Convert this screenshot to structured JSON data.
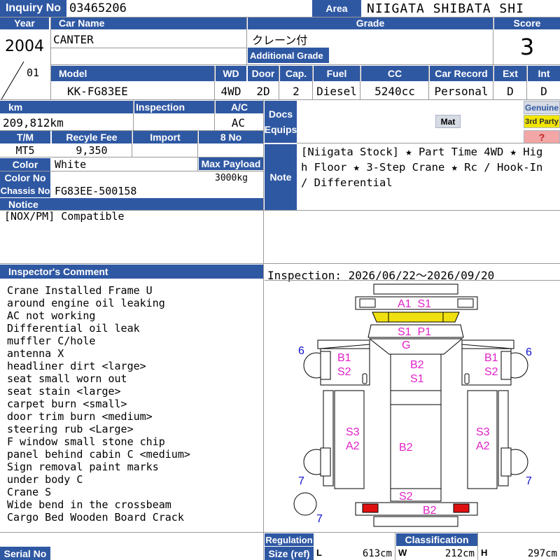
{
  "header": {
    "inquiry_label": "Inquiry No",
    "inquiry_no": "03465206",
    "area_label": "Area",
    "area": "NIIGATA SHIBATA SHI"
  },
  "vehicle": {
    "year_label": "Year",
    "year": "2004",
    "month": "01",
    "car_name_label": "Car Name",
    "car_name": "CANTER",
    "grade_label": "Grade",
    "grade": "クレーン付",
    "additional_grade_label": "Additional Grade",
    "additional_grade": "",
    "score_label": "Score",
    "score": "3"
  },
  "specs": {
    "model_label": "Model",
    "model": "KK-FG83EE",
    "wd_label": "WD",
    "wd": "4WD",
    "door_label": "Door",
    "door": "2D",
    "cap_label": "Cap.",
    "cap": "2",
    "fuel_label": "Fuel",
    "fuel": "Diesel",
    "cc_label": "CC",
    "cc": "5240cc",
    "record_label": "Car Record",
    "record": "Personal",
    "ext_label": "Ext",
    "ext": "D",
    "int_label": "Int",
    "int": "D"
  },
  "details": {
    "km_label": "km",
    "km": "209,812km",
    "inspection_label": "Inspection",
    "inspection": "",
    "ac_label": "A/C",
    "ac": "AC",
    "docs_label": "Docs",
    "equips_label": "Equips",
    "tm_label": "T/M",
    "tm": "MT5",
    "recycle_label": "Recyle Fee",
    "recycle": "9,350",
    "import_label": "Import",
    "import": "",
    "no8_label": "8 No",
    "no8": "",
    "color_label": "Color",
    "color": "White",
    "payload_label": "Max Payload",
    "payload": "3000kg",
    "colorno_label": "Color No",
    "colorno": "",
    "chassis_label": "Chassis No",
    "chassis": "FG83EE-500158",
    "notice_label": "Notice",
    "notice": "[NOX/PM] Compatible"
  },
  "equips": {
    "mat": "Mat",
    "genuine": "Genuine",
    "third_party": "3rd Party",
    "unknown": "?"
  },
  "note": {
    "label": "Note",
    "text": "[Niigata Stock] ★ Part Time 4WD ★ High Floor ★ 3-Step Crane ★ Rc / Hook-In / Differential"
  },
  "inspector": {
    "label": "Inspector's Comment",
    "lines": [
      "Crane Installed Frame U",
      "around engine oil leaking",
      "AC not working",
      "Differential oil leak",
      "muffler C/hole",
      "antenna X",
      "headliner dirt <large>",
      "seat small worn out",
      "seat stain <large>",
      "carpet burn <small>",
      "door trim burn <medium>",
      "steering rub <Large>",
      "F window small stone chip",
      "panel behind cabin C <medium>",
      "Sign removal paint marks",
      "under body C",
      "Crane S",
      "Wide bend in the crossbeam",
      "Cargo Bed Wooden Board Crack"
    ]
  },
  "inspection_period": "Inspection: 2026/06/22〜2026/09/20",
  "diagram_marks": {
    "front_bumper": "A1  S1",
    "cab_top": "S1  P1",
    "cab_top2": "G",
    "left_door": "B1",
    "left_door2": "S2",
    "right_door": "B1",
    "right_door2": "S2",
    "center_cab": "B2",
    "center_cab2": "S1",
    "left_bed": "S3",
    "left_bed2": "A2",
    "right_bed": "S3",
    "right_bed2": "A2",
    "center_bed": "B2",
    "rear_s2": "S2",
    "rear_b2": "B2",
    "tyre_fl": "6",
    "tyre_fr": "6",
    "tyre_rl": "7",
    "tyre_rr": "7",
    "tyre_spare": "7",
    "damage_color": "#e020c8",
    "tyre_color": "#1010d0"
  },
  "footer": {
    "serial_label": "Serial No",
    "serial": "",
    "regulation_label": "Regulation",
    "regulation": "",
    "classification_label": "Classification",
    "classification": "",
    "size_label": "Size (ref)",
    "l_label": "L",
    "l": "613cm",
    "w_label": "W",
    "w": "212cm",
    "h_label": "H",
    "h": "297cm"
  },
  "colors": {
    "header_blue": "#2f58a3",
    "badge_yellow": "#f2e600",
    "badge_pink": "#f2a6a6",
    "badge_gray": "#d7dbe3"
  }
}
